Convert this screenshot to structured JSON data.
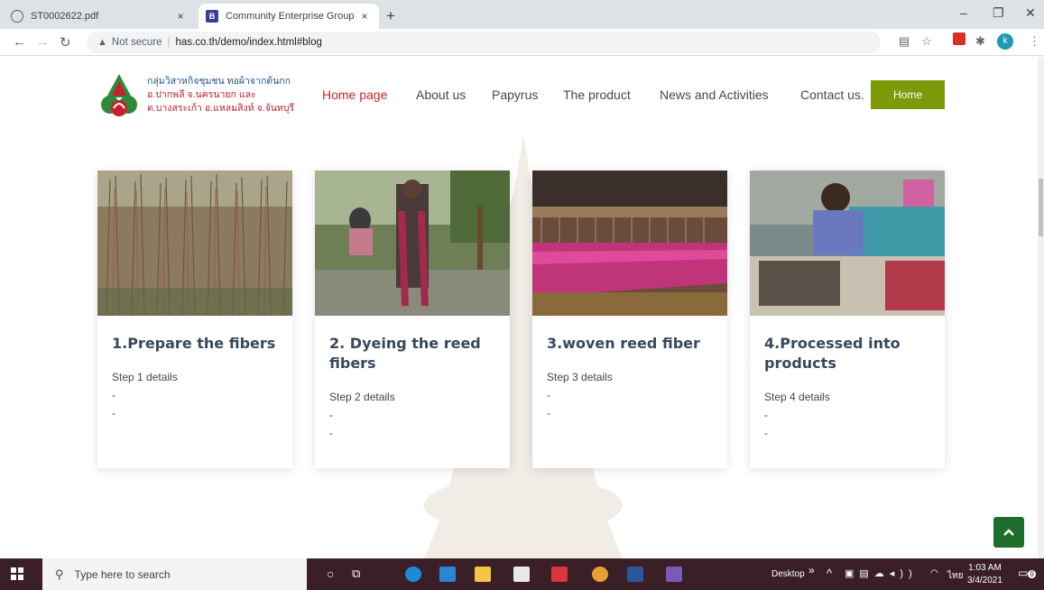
{
  "browser": {
    "tabs": [
      {
        "title": "ST0002622.pdf",
        "active": false
      },
      {
        "title": "Community Enterprise Group We",
        "active": true
      }
    ],
    "new_tab": "+",
    "tab_close": "×",
    "window_controls": [
      "–",
      "❐",
      "✕"
    ],
    "address": {
      "security": "Not secure",
      "url": "has.co.th/demo/index.html#blog"
    },
    "nav_icons": [
      "back-icon",
      "forward-icon",
      "reload-icon"
    ],
    "profile_initial": "k"
  },
  "site": {
    "logo_lines": [
      "กลุ่มวิสาหกิจชุมชน ทอผ้าจากต้นกก",
      "อ.ปากพลี จ.นครนายก และ",
      "ต.บางสระเก้า อ.แหลมสิงห์ จ.จันทบุรี"
    ],
    "nav": [
      "Home page",
      "About us",
      "Papyrus",
      "The product",
      "News and Activities",
      "Contact us."
    ],
    "home_button": "Home",
    "active_nav": "Home page"
  },
  "cards": [
    {
      "title": "1.Prepare the fibers",
      "details": "Step 1 details",
      "lines": [
        "-",
        "-"
      ],
      "image": "reed-field-photo"
    },
    {
      "title": "2. Dyeing the reed fibers",
      "details": "Step 2 details",
      "lines": [
        "-",
        "-"
      ],
      "image": "dyeing-photo"
    },
    {
      "title": "3.woven reed fiber",
      "details": "Step 3 details",
      "lines": [
        "-",
        "-"
      ],
      "image": "loom-photo"
    },
    {
      "title": "4.Processed into products",
      "details": "Step 4 details",
      "lines": [
        "-",
        "-"
      ],
      "image": "sewing-photo"
    }
  ],
  "back_to_top": "^",
  "taskbar": {
    "search_placeholder": "Type here to search",
    "desktop_label": "Desktop",
    "clock_time": "1:03 AM",
    "clock_date": "3/4/2021",
    "language": "ไทย",
    "notification_count": "9"
  },
  "colors": {
    "accent_nav": "#c0272d",
    "home_button": "#7c9a0a",
    "back_to_top": "#1f6d2b",
    "card_title": "#36485c"
  }
}
